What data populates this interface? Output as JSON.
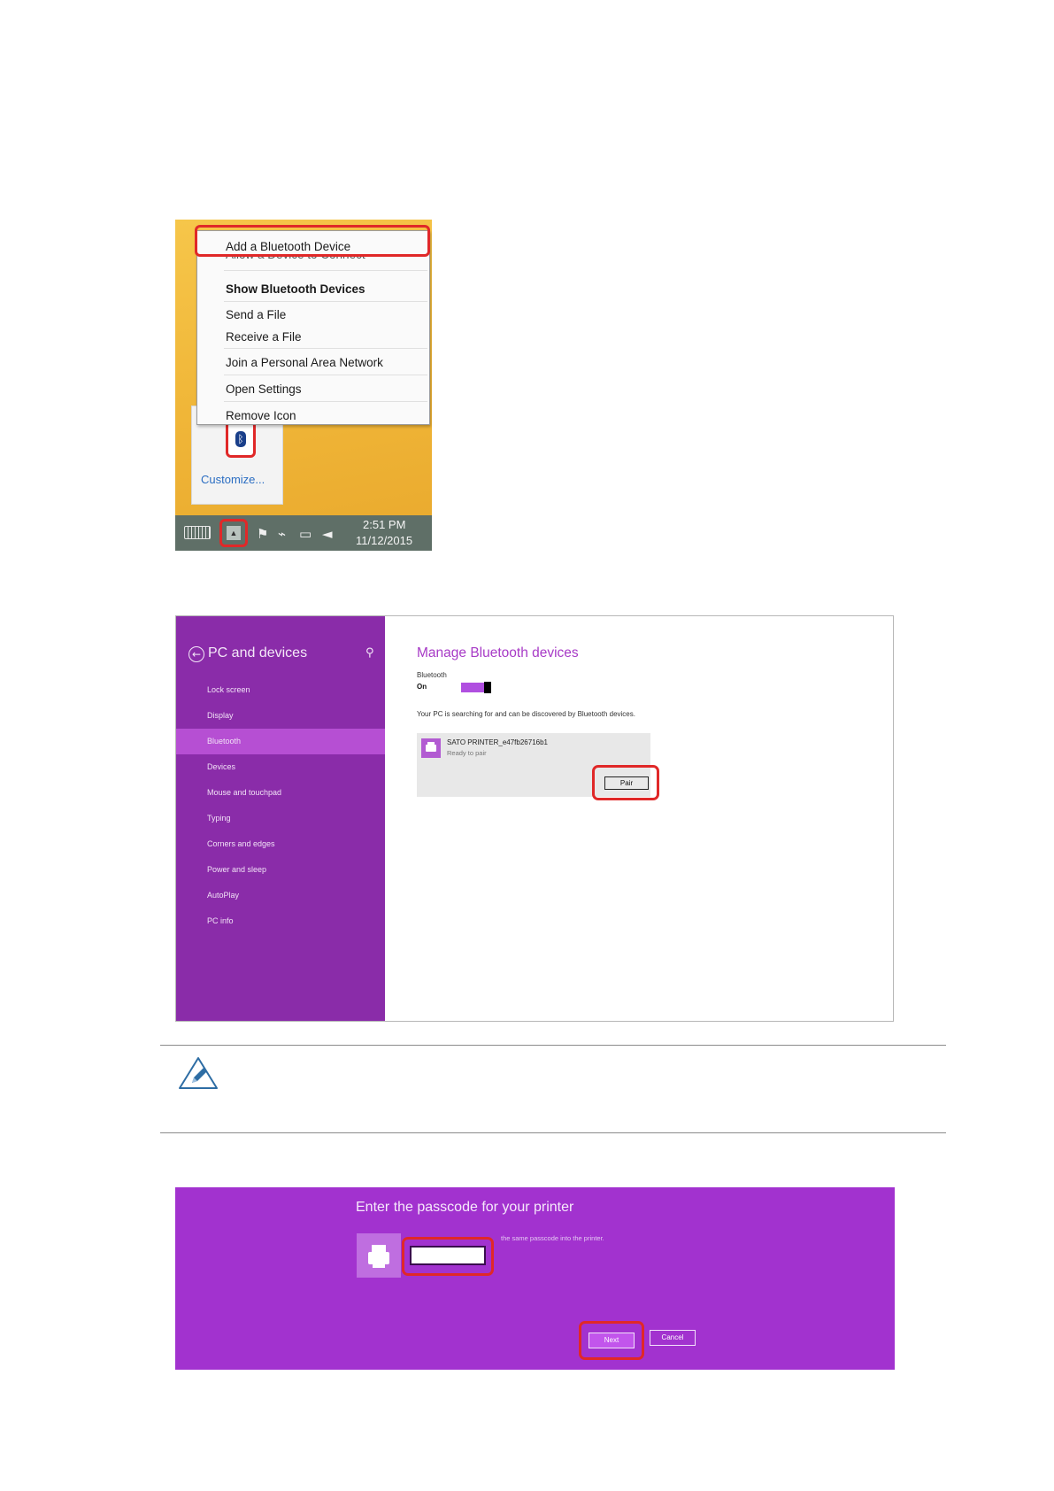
{
  "tray_menu": {
    "items": [
      {
        "label": "Add a Bluetooth Device",
        "bold": false
      },
      {
        "label": "Allow a Device to Connect",
        "bold": false
      },
      {
        "label": "Show Bluetooth Devices",
        "bold": true
      },
      {
        "label": "Send a File",
        "bold": false
      },
      {
        "label": "Receive a File",
        "bold": false
      },
      {
        "label": "Join a Personal Area Network",
        "bold": false
      },
      {
        "label": "Open Settings",
        "bold": false
      },
      {
        "label": "Remove Icon",
        "bold": false
      }
    ],
    "customize_link": "Customize...",
    "bluetooth_icon": "bluetooth-icon",
    "clock_time": "2:51 PM",
    "clock_date": "11/12/2015"
  },
  "pc_settings": {
    "sidebar_title": "PC and devices",
    "sidebar_items": [
      "Lock screen",
      "Display",
      "Bluetooth",
      "Devices",
      "Mouse and touchpad",
      "Typing",
      "Corners and edges",
      "Power and sleep",
      "AutoPlay",
      "PC info"
    ],
    "active_item_index": 2,
    "page_title": "Manage Bluetooth devices",
    "bluetooth_label": "Bluetooth",
    "bluetooth_state": "On",
    "search_message": "Your PC is searching for and can be discovered by Bluetooth devices.",
    "device": {
      "name": "SATO PRINTER_e47fb26716b1",
      "status": "Ready to pair",
      "pair_label": "Pair"
    }
  },
  "note": {
    "icon": "pencil-icon"
  },
  "passcode_dialog": {
    "title": "Enter the passcode for your printer",
    "instruction": "the same passcode into the printer.",
    "input_value": "",
    "next_label": "Next",
    "cancel_label": "Cancel"
  },
  "colors": {
    "highlight_red": "#e02828",
    "settings_purple": "#8a2ca9",
    "active_item_purple": "#b64fd3",
    "dialog_purple": "#a232cf"
  }
}
